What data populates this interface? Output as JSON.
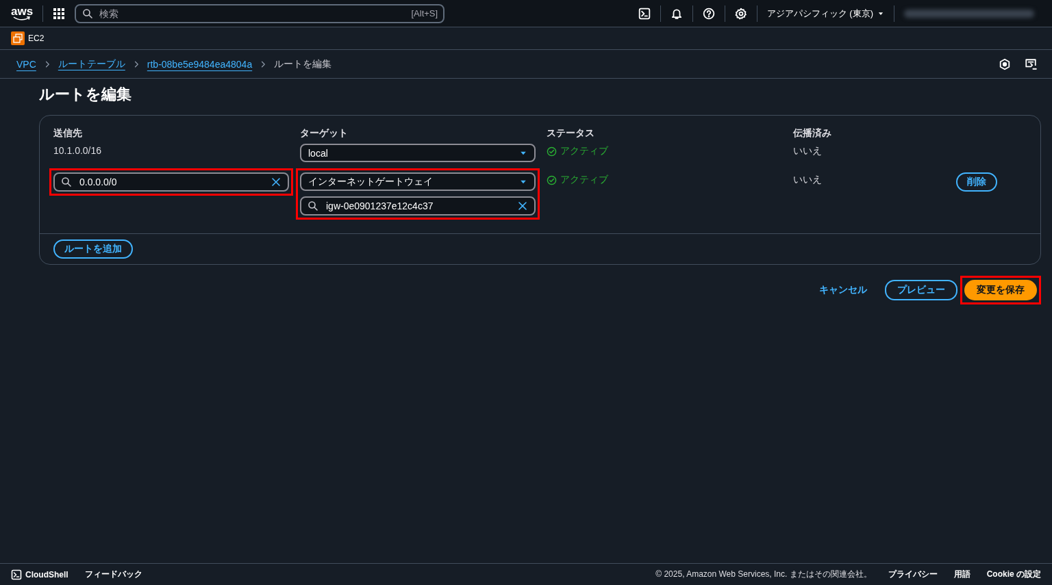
{
  "top_bar": {
    "logo": "aws",
    "search": {
      "placeholder": "検索",
      "shortcut": "[Alt+S]"
    },
    "region": "アジアパシフィック (東京)"
  },
  "service_bar": {
    "service": "EC2"
  },
  "breadcrumbs": [
    {
      "label": "VPC",
      "link": true
    },
    {
      "label": "ルートテーブル",
      "link": true
    },
    {
      "label": "rtb-08be5e9484ea4804a",
      "link": true
    },
    {
      "label": "ルートを編集",
      "link": false
    }
  ],
  "title": "ルートを編集",
  "table": {
    "columns": [
      "送信先",
      "ターゲット",
      "ステータス",
      "伝播済み"
    ],
    "rows": [
      {
        "destination": {
          "kind": "text",
          "value": "10.1.0.0/16",
          "highlighted": false
        },
        "target": {
          "select": "local",
          "highlighted": false
        },
        "status": "アクティブ",
        "propagated": "いいえ",
        "remove_button": null
      },
      {
        "destination": {
          "kind": "search",
          "value": "0.0.0.0/0",
          "highlighted": true
        },
        "target": {
          "select": "インターネットゲートウェイ",
          "search": "igw-0e0901237e12c4c37",
          "highlighted": true
        },
        "status": "アクティブ",
        "propagated": "いいえ",
        "remove_button": "削除"
      }
    ],
    "add_button": "ルートを追加"
  },
  "actions": {
    "cancel": "キャンセル",
    "preview": "プレビュー",
    "save": {
      "label": "変更を保存",
      "highlighted": true
    }
  },
  "footer": {
    "left": [
      "CloudShell",
      "フィードバック"
    ],
    "copyright": "© 2025, Amazon Web Services, Inc. またはその関連会社。",
    "links": [
      "プライバシー",
      "用語",
      "Cookie の設定"
    ]
  }
}
